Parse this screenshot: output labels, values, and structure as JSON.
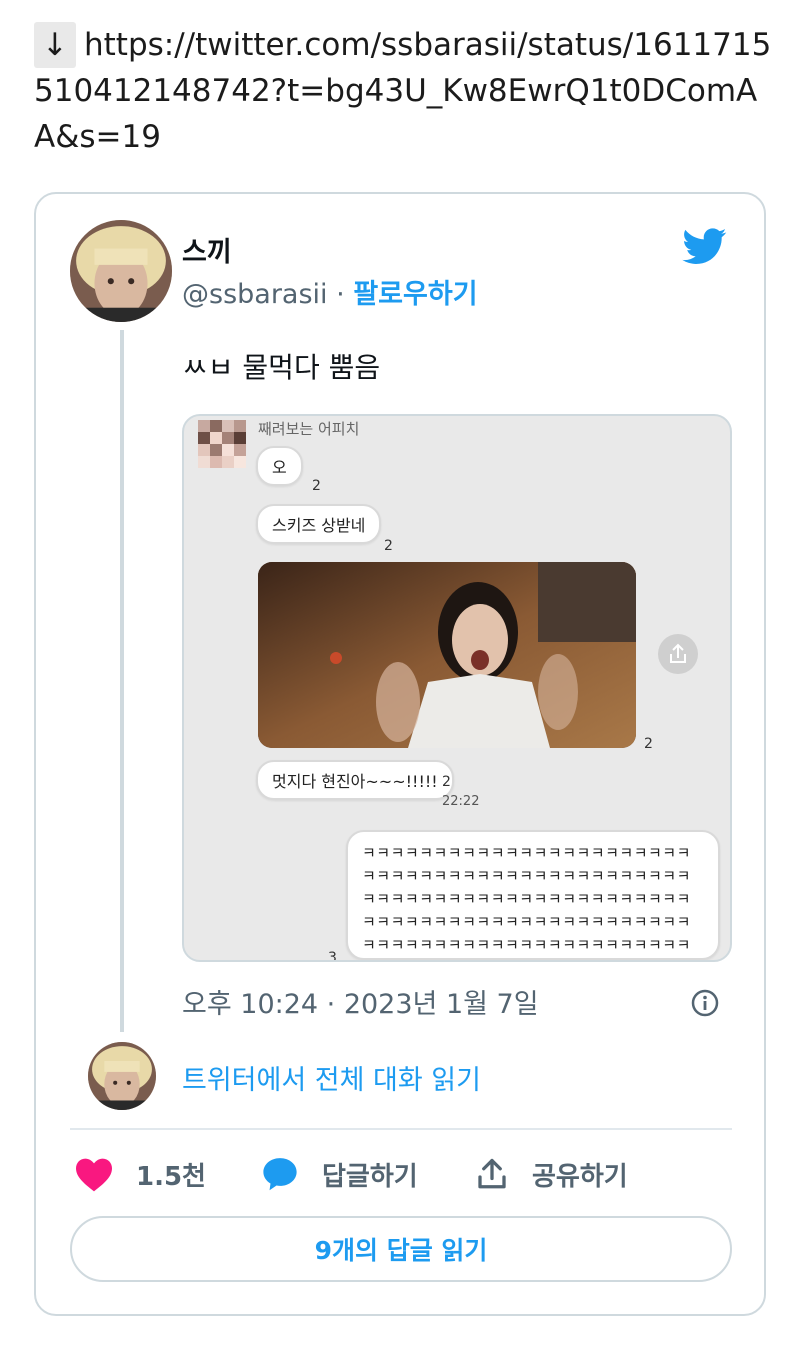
{
  "url_line": {
    "arrow": "↓",
    "text": "https://twitter.com/ssbarasii/status/1611715510412148742?t=bg43U_Kw8EwrQ1t0DComAA&s=19"
  },
  "tweet": {
    "display_name": "스끼",
    "handle": "@ssbarasii",
    "separator": "·",
    "follow_label": "팔로우하기",
    "text": "ㅆㅂ 물먹다 뿜음",
    "timestamp": "오후 10:24 · 2023년 1월 7일",
    "read_thread_label": "트위터에서 전체 대화 읽기",
    "likes": "1.5천",
    "reply_label": "답글하기",
    "share_label": "공유하기",
    "read_replies_label": "9개의 답글 읽기"
  },
  "chat_image": {
    "sender_name": "째려보는 어피치",
    "messages": [
      {
        "text": "오",
        "count": "2"
      },
      {
        "text": "스키즈 상받네",
        "count": "2"
      },
      {
        "text": "멋지다 현진아~~~!!!!!",
        "count": "2",
        "time": "22:22"
      }
    ],
    "image_count": "2",
    "reply_text": "ㅋㅋㅋㅋㅋㅋㅋㅋㅋㅋㅋㅋㅋㅋㅋㅋㅋㅋㅋㅋㅋㅋㅋㅋㅋㅋㅋㅋㅋㅋㅋㅋㅋㅋㅋㅋㅋㅋㅋㅋㅋㅋㅋㅋㅋㅋㅋㅋㅋㅋㅋㅋㅋㅋㅋㅋㅋㅋㅋㅋㅋㅋㅋㅋㅋㅋㅋㅋㅋㅋㅋㅋㅋㅋㅋㅋㅋㅋㅋㅋㅋㅋㅋㅋㅋㅋㅋㅋㅋㅋㅋㅋㅋㅋㅋㅋㅋㅋㅋㅋㅋㅋㅋㅋㅋㅋㅋㅋㅋㅋㅋㅋㅋㅋㅋㅋㅋㅋㅋㅋㅋㅋㅋㅋㅋㅋㅋㅋㅋㅋㅋㅋㅋㅋㅋㅋㅋㅋ",
    "reply_count": "3"
  },
  "icons": {
    "twitter": "twitter-bird-icon",
    "like": "heart-icon",
    "reply": "speech-bubble-icon",
    "share": "share-upload-icon",
    "info": "info-icon"
  },
  "colors": {
    "accent": "#1d9bf0",
    "like": "#f91880",
    "muted": "#536471",
    "border": "#cfd9de"
  }
}
